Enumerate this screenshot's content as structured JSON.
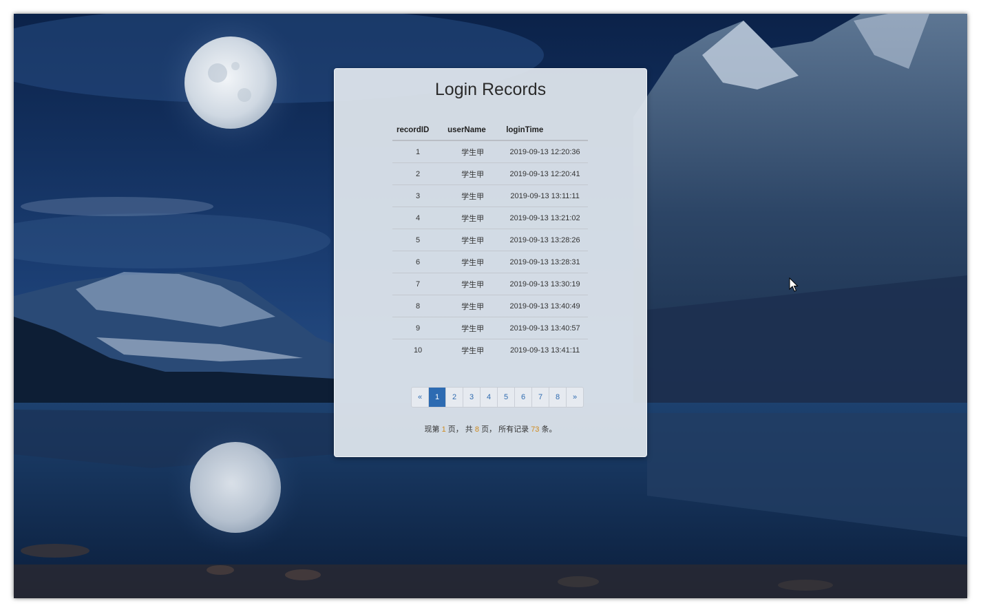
{
  "card": {
    "title": "Login Records"
  },
  "table": {
    "headers": [
      "recordID",
      "userName",
      "loginTime"
    ],
    "rows": [
      [
        "1",
        "学生甲",
        "2019-09-13 12:20:36"
      ],
      [
        "2",
        "学生甲",
        "2019-09-13 12:20:41"
      ],
      [
        "3",
        "学生甲",
        "2019-09-13 13:11:11"
      ],
      [
        "4",
        "学生甲",
        "2019-09-13 13:21:02"
      ],
      [
        "5",
        "学生甲",
        "2019-09-13 13:28:26"
      ],
      [
        "6",
        "学生甲",
        "2019-09-13 13:28:31"
      ],
      [
        "7",
        "学生甲",
        "2019-09-13 13:30:19"
      ],
      [
        "8",
        "学生甲",
        "2019-09-13 13:40:49"
      ],
      [
        "9",
        "学生甲",
        "2019-09-13 13:40:57"
      ],
      [
        "10",
        "学生甲",
        "2019-09-13 13:41:11"
      ]
    ]
  },
  "pagination": {
    "prev": "«",
    "pages": [
      "1",
      "2",
      "3",
      "4",
      "5",
      "6",
      "7",
      "8"
    ],
    "active_page": "1",
    "next": "»"
  },
  "summary": {
    "prefix": "现第",
    "current_page": "1",
    "mid1": "页， 共",
    "total_pages": "8",
    "mid2": "页， 所有记录",
    "total_records": "73",
    "suffix": "条。"
  },
  "colors": {
    "accent": "#2d6bb2",
    "highlight": "#d08a1c",
    "sky": "#0e2a55",
    "card": "#e1e7ee"
  },
  "icons": {
    "cursor": "mouse-pointer-icon"
  }
}
